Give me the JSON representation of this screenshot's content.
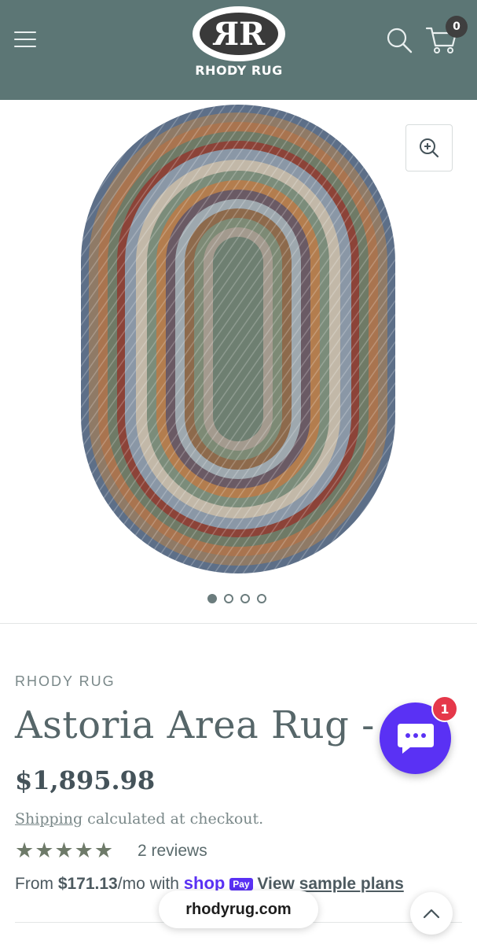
{
  "header": {
    "logo_mark": "RR",
    "logo_text": "RHODY RUG",
    "cart_count": "0",
    "background_color": "#5c7675"
  },
  "gallery": {
    "image_count": 4,
    "active_index": 0
  },
  "product": {
    "vendor": "RHODY RUG",
    "title": "Astoria Area Rug - C",
    "price": "$1,895.98",
    "shipping_link": "Shipping",
    "shipping_text": " calculated at checkout.",
    "rating": 5,
    "stars": "★★★★★",
    "reviews": "2 reviews",
    "installments_prefix": "From ",
    "installments_amount": "$171.13",
    "installments_mid": "/mo with ",
    "shop_logo": "shop",
    "pay_badge": "Pay",
    "sample_plans": "View sample plans"
  },
  "chat": {
    "badge_count": "1",
    "color": "#5a31f4"
  },
  "browser": {
    "url": "rhodyrug.com"
  }
}
